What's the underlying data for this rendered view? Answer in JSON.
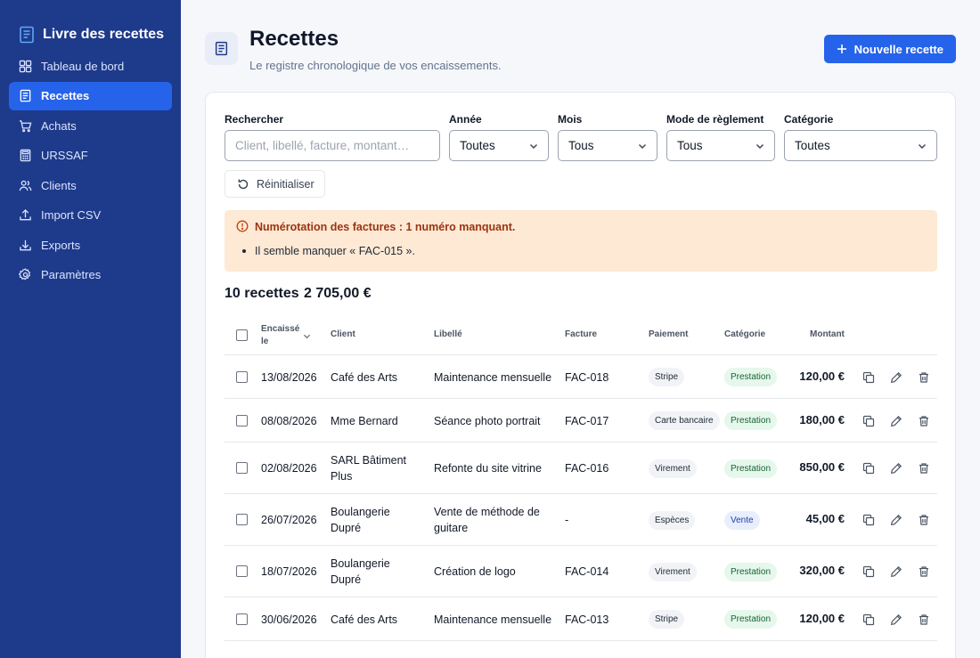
{
  "app": {
    "brand": "Livre des recettes"
  },
  "sidebar": {
    "items": [
      {
        "label": "Tableau de bord",
        "icon": "dashboard-grid-icon"
      },
      {
        "label": "Recettes",
        "icon": "receipt-icon",
        "active": true
      },
      {
        "label": "Achats",
        "icon": "cart-icon"
      },
      {
        "label": "URSSAF",
        "icon": "calculator-icon"
      },
      {
        "label": "Clients",
        "icon": "users-icon"
      },
      {
        "label": "Import CSV",
        "icon": "upload-icon"
      },
      {
        "label": "Exports",
        "icon": "download-icon"
      },
      {
        "label": "Paramètres",
        "icon": "gear-icon"
      }
    ]
  },
  "header": {
    "title": "Recettes",
    "subtitle": "Le registre chronologique de vos encaissements.",
    "new_button": "Nouvelle recette"
  },
  "filters": {
    "search": {
      "label": "Rechercher",
      "placeholder": "Client, libellé, facture, montant…"
    },
    "year": {
      "label": "Année",
      "value": "Toutes"
    },
    "month": {
      "label": "Mois",
      "value": "Tous"
    },
    "payment": {
      "label": "Mode de règlement",
      "value": "Tous"
    },
    "category": {
      "label": "Catégorie",
      "value": "Toutes"
    },
    "reset": "Réinitialiser"
  },
  "alert": {
    "title": "Numérotation des factures : 1 numéro manquant.",
    "item": "Il semble manquer « FAC-015 »."
  },
  "summary": {
    "count": "10 recettes",
    "total": "2 705,00 €"
  },
  "table": {
    "headers": {
      "date_line1": "Encaissé",
      "date_line2": "le",
      "client": "Client",
      "label": "Libellé",
      "invoice": "Facture",
      "payment": "Paiement",
      "category": "Catégorie",
      "amount": "Montant"
    },
    "rows": [
      {
        "date": "13/08/2026",
        "client": [
          "Café des Arts"
        ],
        "label": [
          "Maintenance mensuelle"
        ],
        "invoice": "FAC-018",
        "payment": "Stripe",
        "category": "Prestation",
        "amount": "120,00 €"
      },
      {
        "date": "08/08/2026",
        "client": [
          "Mme Bernard"
        ],
        "label": [
          "Séance photo portrait"
        ],
        "invoice": "FAC-017",
        "payment": "Carte bancaire",
        "category": "Prestation",
        "amount": "180,00 €"
      },
      {
        "date": "02/08/2026",
        "client": [
          "SARL Bâtiment",
          "Plus"
        ],
        "label": [
          "Refonte du site vitrine"
        ],
        "invoice": "FAC-016",
        "payment": "Virement",
        "category": "Prestation",
        "amount": "850,00 €"
      },
      {
        "date": "26/07/2026",
        "client": [
          "Boulangerie",
          "Dupré"
        ],
        "label": [
          "Vente de méthode de",
          "guitare"
        ],
        "invoice": "-",
        "payment": "Espèces",
        "category": "Vente",
        "amount": "45,00 €"
      },
      {
        "date": "18/07/2026",
        "client": [
          "Boulangerie",
          "Dupré"
        ],
        "label": [
          "Création de logo"
        ],
        "invoice": "FAC-014",
        "payment": "Virement",
        "category": "Prestation",
        "amount": "320,00 €"
      },
      {
        "date": "30/06/2026",
        "client": [
          "Café des Arts"
        ],
        "label": [
          "Maintenance mensuelle"
        ],
        "invoice": "FAC-013",
        "payment": "Stripe",
        "category": "Prestation",
        "amount": "120,00 €"
      }
    ]
  },
  "colors": {
    "sidebar": "#1e3a8a",
    "accent": "#2563eb",
    "alert_bg": "#fde9d4",
    "alert_text": "#9a3412"
  }
}
